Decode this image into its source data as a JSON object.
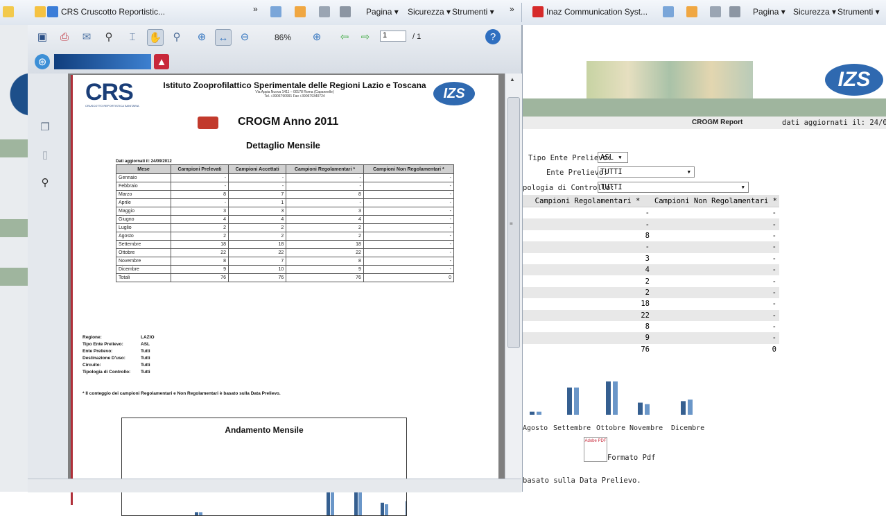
{
  "browser": {
    "left_tab_title": "CRS Cruscotto Reportistic...",
    "right_tab_title": "Inaz Communication Syst...",
    "menu_pagina": "Pagina ▾",
    "menu_sicurezza": "Sicurezza ▾",
    "menu_strumenti": "Strumenti ▾",
    "chevron": "»"
  },
  "pdf_viewer": {
    "zoom": "86%",
    "page_number": "1",
    "page_total": "/ 1"
  },
  "pdf_doc": {
    "institute": "Istituto Zooprofilattico Sperimentale delle Regioni Lazio e Toscana",
    "address": "Via Appia Nuova 1411 – 00178 Roma (Capannelle)",
    "tel": "Tel. +3906790991 Fax +390679340724",
    "crs_logo": "CRS",
    "crs_sub": "CRUSCOTTO REPORTISTICA SANITARIA",
    "izs_logo": "IZS",
    "report_title": "CROGM Anno 2011",
    "subtitle": "Dettaglio Mensile",
    "updated": "Dati aggiornati il: 24/09/2012",
    "columns": [
      "Mese",
      "Campioni Prelevati",
      "Campioni Accettati",
      "Campioni Regolamentari *",
      "Campioni Non Regolamentari *"
    ],
    "rows": [
      [
        "Gennaio",
        "-",
        "-",
        "-",
        "-"
      ],
      [
        "Febbraio",
        "-",
        "-",
        "-",
        "-"
      ],
      [
        "Marzo",
        "8",
        "7",
        "8",
        "-"
      ],
      [
        "Aprile",
        "-",
        "1",
        "-",
        "-"
      ],
      [
        "Maggio",
        "3",
        "3",
        "3",
        "-"
      ],
      [
        "Giugno",
        "4",
        "4",
        "4",
        "-"
      ],
      [
        "Luglio",
        "2",
        "2",
        "2",
        "-"
      ],
      [
        "Agosto",
        "2",
        "2",
        "2",
        "-"
      ],
      [
        "Settembre",
        "18",
        "18",
        "18",
        "-"
      ],
      [
        "Ottobre",
        "22",
        "22",
        "22",
        "-"
      ],
      [
        "Novembre",
        "8",
        "7",
        "8",
        "-"
      ],
      [
        "Dicembre",
        "9",
        "10",
        "9",
        "-"
      ],
      [
        "Totali",
        "76",
        "76",
        "76",
        "0"
      ]
    ],
    "filters": [
      {
        "label": "Regione:",
        "value": "LAZIO"
      },
      {
        "label": "Tipo Ente Prelievo:",
        "value": "ASL"
      },
      {
        "label": "Ente Prelievo:",
        "value": "Tutti"
      },
      {
        "label": "Destinazione D'uso:",
        "value": "Tutti"
      },
      {
        "label": "Circuito:",
        "value": "Tutti"
      },
      {
        "label": "Tipologia di Controllo:",
        "value": "Tutti"
      }
    ],
    "footnote": "* Il conteggio dei campioni Regolamentari e Non Regolamentari è basato sulla Data Prelievo.",
    "chart_title": "Andamento Mensile"
  },
  "right_page": {
    "crogm_report": "CROGM Report",
    "updated": "dati aggiornati il: 24/09/2012",
    "izs_logo": "IZS",
    "tipo_ente_label": "Tipo Ente Prelievo:",
    "tipo_ente_value": "ASL",
    "ente_label": "Ente Prelievo:",
    "ente_value": "TUTTI",
    "tipologia_label": "pologia di Controllo:",
    "tipologia_value": "TUTTI",
    "col_regolamentari": "Campioni Regolamentari *",
    "col_non_regolamentari": "Campioni Non Regolamentari *",
    "rows": [
      [
        "-",
        "-"
      ],
      [
        "-",
        "-"
      ],
      [
        "8",
        "-"
      ],
      [
        "-",
        "-"
      ],
      [
        "3",
        "-"
      ],
      [
        "4",
        "-"
      ],
      [
        "2",
        "-"
      ],
      [
        "2",
        "-"
      ],
      [
        "18",
        "-"
      ],
      [
        "22",
        "-"
      ],
      [
        "8",
        "-"
      ],
      [
        "9",
        "-"
      ],
      [
        "76",
        "0"
      ]
    ],
    "formato_pdf": "Formato Pdf",
    "pdf_icon_label": "Adobe PDF",
    "footer_text": "basato sulla Data Prelievo."
  },
  "chart_data": [
    {
      "type": "bar",
      "title": "Andamento Mensile",
      "categories": [
        "Agosto",
        "Settembre",
        "Ottobre",
        "Novembre",
        "Dicembre"
      ],
      "series": [
        {
          "values": [
            2,
            18,
            22,
            8,
            9
          ]
        },
        {
          "values": [
            2,
            18,
            22,
            7,
            10
          ]
        }
      ],
      "colors": [
        "#355f90",
        "#6a96c8"
      ]
    }
  ]
}
